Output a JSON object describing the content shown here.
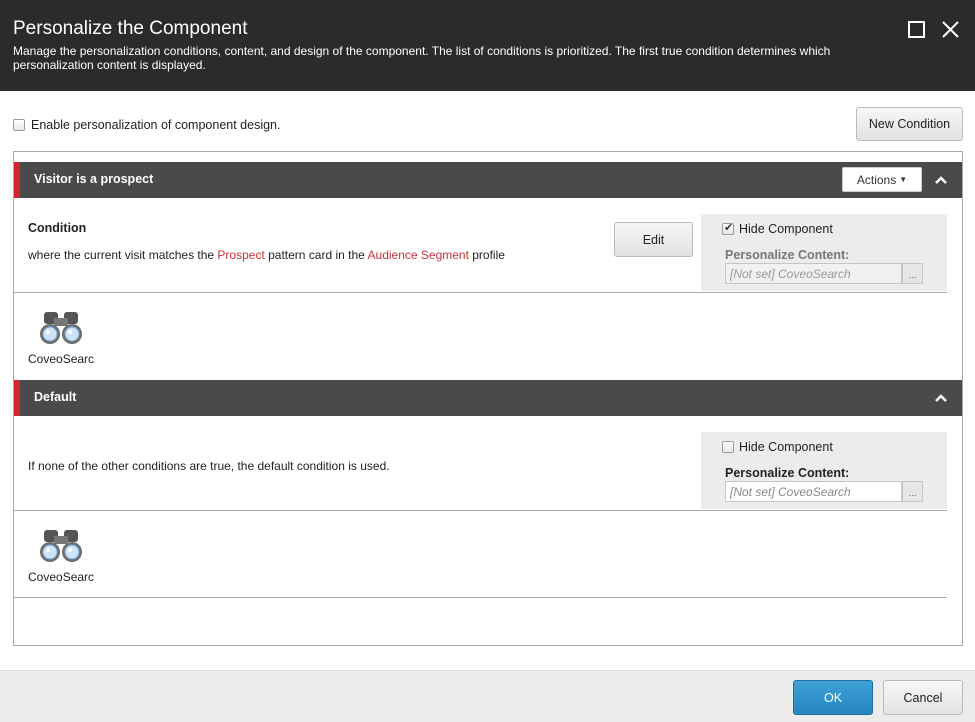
{
  "dialog": {
    "title": "Personalize the Component",
    "description": "Manage the personalization conditions, content, and design of the component. The list of conditions is prioritized. The first true condition determines which personalization content is displayed."
  },
  "enable_design": {
    "label": "Enable personalization of component design.",
    "checked": false
  },
  "new_condition_label": "New Condition",
  "conditions": [
    {
      "name": "Visitor is a prospect",
      "actions_label": "Actions",
      "heading": "Condition",
      "rule": {
        "pre": "where the current visit matches the ",
        "link1": "Prospect",
        "mid": " pattern card in the ",
        "link2": "Audience Segment",
        "post": " profile"
      },
      "edit_label": "Edit",
      "hide_component_label": "Hide Component",
      "hide_component_checked": true,
      "personalize_content_label": "Personalize Content:",
      "content_value": "[Not set] CoveoSearch",
      "browse_label": "...",
      "component_name": "CoveoSearch"
    },
    {
      "name": "Default",
      "text": "If none of the other conditions are true, the default condition is used.",
      "hide_component_label": "Hide Component",
      "hide_component_checked": false,
      "personalize_content_label": "Personalize Content:",
      "content_value": "[Not set] CoveoSearch",
      "browse_label": "...",
      "component_name": "CoveoSearch"
    }
  ],
  "footer": {
    "ok_label": "OK",
    "cancel_label": "Cancel"
  },
  "colors": {
    "titlebar": "#2b2b2b",
    "section_header": "#4a4a4a",
    "accent_red": "#d0272f",
    "link": "#c8333b",
    "ok_blue": "#2785c0"
  },
  "icons": [
    "maximize-icon",
    "close-icon",
    "caret-down-icon",
    "chevron-up-icon",
    "binoculars-icon"
  ]
}
